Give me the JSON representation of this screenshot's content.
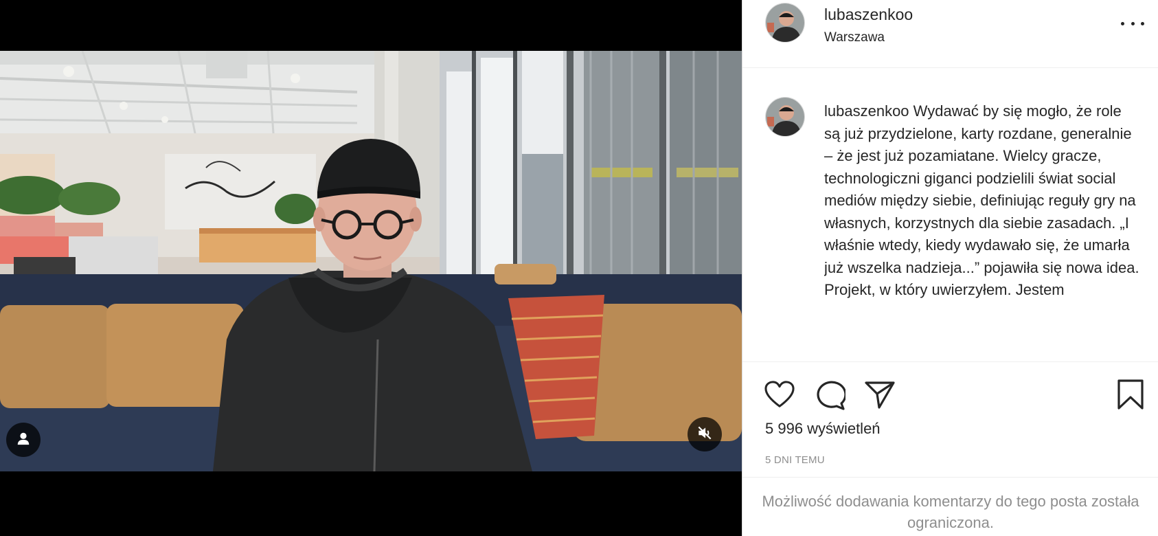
{
  "post": {
    "username": "lubaszenkoo",
    "location": "Warszawa",
    "caption_username": "lubaszenkoo",
    "caption_text": "Wydawać by się mogło, że role są już przydzielone, karty rozdane, generalnie – że jest już pozamiatane. Wielcy gracze, technologiczni giganci podzielili świat social mediów między siebie, definiując reguły gry na własnych, korzystnych dla siebie zasadach. „I właśnie wtedy, kiedy wydawało się, że umarła już wszelka nadzieja...” pojawiła się nowa idea. Projekt, w który uwierzyłem. Jestem",
    "views": "5 996 wyświetleń",
    "date": "5 DNI TEMU",
    "comments_notice": "Możliwość dodawania komentarzy do tego posta została ograniczona."
  },
  "icons": {
    "more": "more-options-icon",
    "like": "heart-icon",
    "comment": "comment-icon",
    "share": "share-icon",
    "save": "bookmark-icon",
    "tagged_users": "user-tag-icon",
    "mute": "speaker-muted-icon"
  },
  "colors": {
    "text": "#262626",
    "secondary": "#8e8e8e",
    "border": "#dbdbdb"
  }
}
